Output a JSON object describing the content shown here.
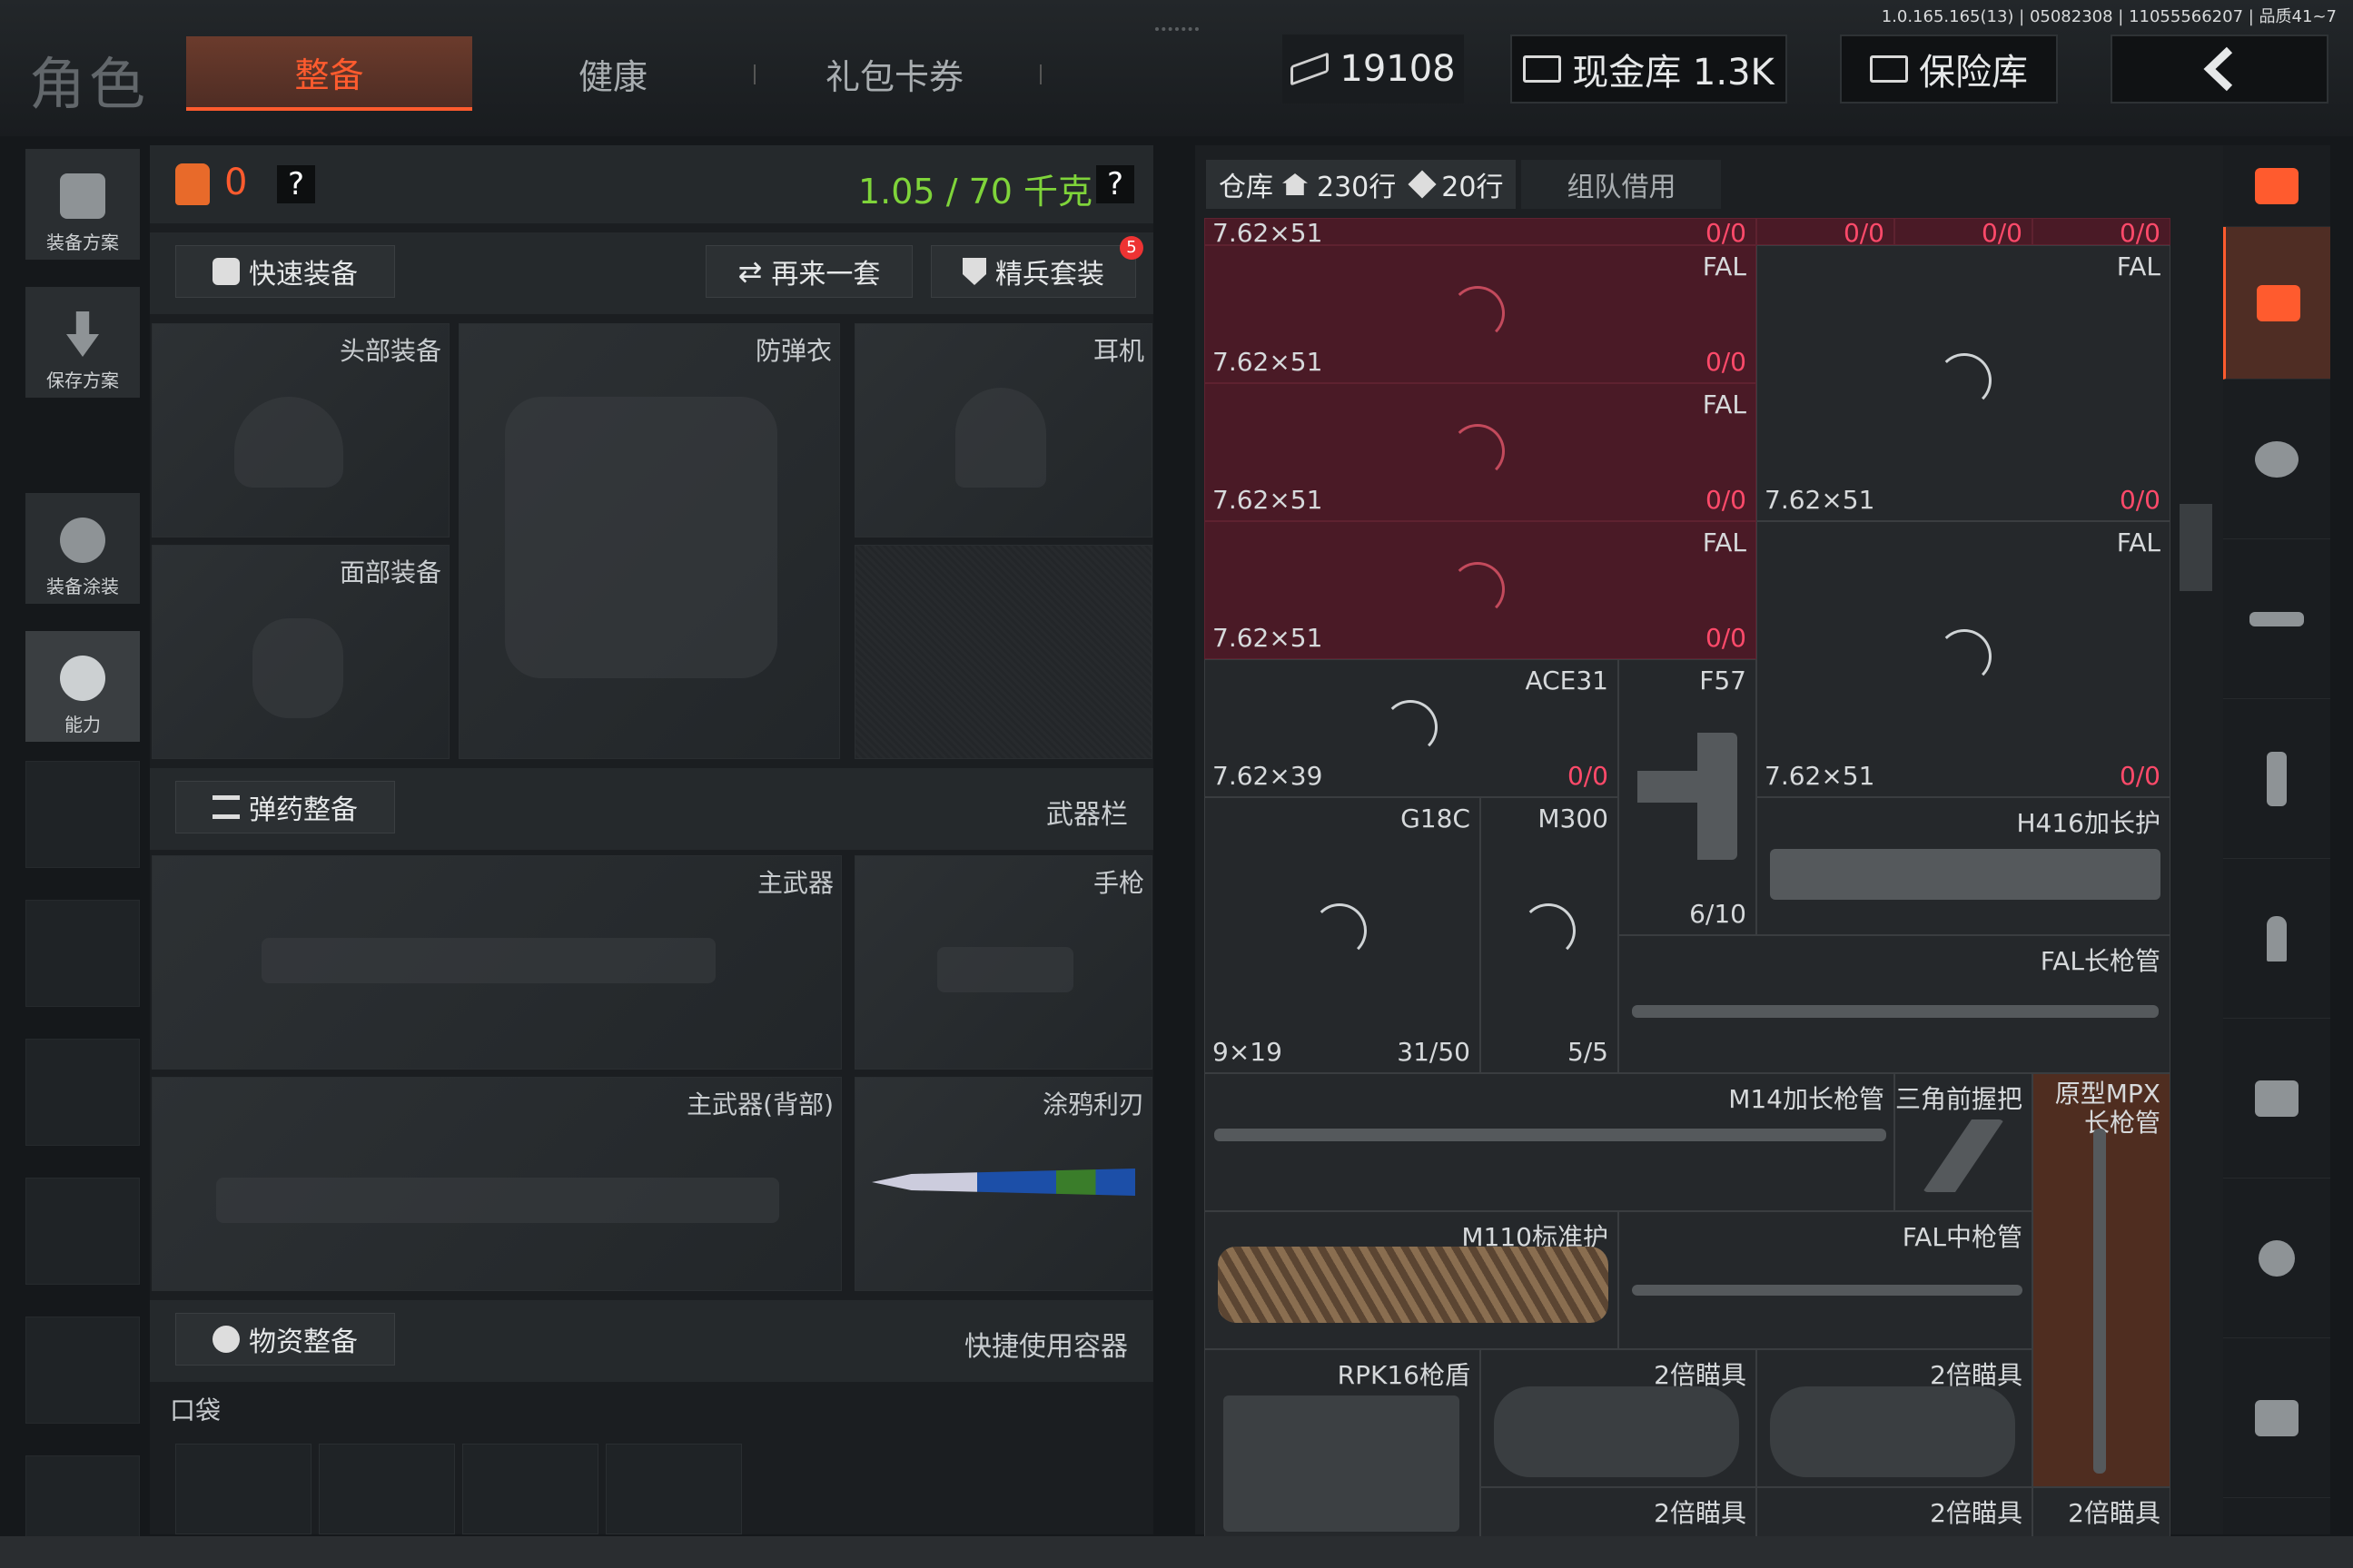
{
  "version": "1.0.165.165(13) | 05082308 | 11055566207 | 品质41~7",
  "title": "角色",
  "tabs": [
    "整备",
    "健康",
    "礼包卡券"
  ],
  "money": "19108",
  "cash": "现金库 1.3K",
  "safe": "保险库",
  "leftnav": [
    "装备方案",
    "保存方案",
    "装备涂装",
    "能力"
  ],
  "loadout": {
    "count": "0",
    "q": "?",
    "weight": "1.05 / 70 千克",
    "quick": "快速装备",
    "again": "再来一套",
    "elite": "精兵套装",
    "elite_badge": "5"
  },
  "slots": {
    "head": "头部装备",
    "armor": "防弹衣",
    "ear": "耳机",
    "face": "面部装备",
    "ammo": "弹药整备",
    "weapon_bar": "武器栏",
    "main": "主武器",
    "pistol": "手枪",
    "mainback": "主武器(背部)",
    "knife": "涂鸦利刃",
    "supply": "物资整备",
    "quickuse": "快捷使用容器",
    "pocket": "口袋"
  },
  "warehouse": {
    "title": "仓库",
    "rows": "230行",
    "rows2": "20行",
    "team": "组队借用"
  },
  "cells": [
    {
      "n": "FAL",
      "cal": "7.62×51",
      "amt": "0/0"
    },
    {
      "n": "FAL",
      "cal": "7.62×51",
      "amt": "0/0"
    },
    {
      "n": "FAL",
      "cal": "7.62×51",
      "amt": "0/0"
    },
    {
      "n": "FAL",
      "cal": "7.62×51",
      "amt": "0/0"
    },
    {
      "n": "FAL",
      "cal": "7.62×51",
      "amt": "0/0"
    },
    {
      "n": "ACE31",
      "cal": "7.62×39",
      "amt": "0/0"
    },
    {
      "n": "F57",
      "cal": "",
      "amt": "6/10"
    },
    {
      "n": "",
      "cal": "7.62×51",
      "amt": "0/0"
    },
    {
      "n": "G18C",
      "cal": "9×19",
      "amt": "31/50"
    },
    {
      "n": "M300",
      "cal": "",
      "amt": "5/5"
    },
    {
      "n": "H416加长护",
      "cal": "",
      "amt": ""
    },
    {
      "n": "FAL长枪管",
      "cal": "",
      "amt": ""
    },
    {
      "n": "M14加长枪管",
      "cal": "",
      "amt": ""
    },
    {
      "n": "三角前握把",
      "cal": "",
      "amt": ""
    },
    {
      "n": "原型MPX长枪管",
      "cal": "",
      "amt": ""
    },
    {
      "n": "M110标准护",
      "cal": "",
      "amt": ""
    },
    {
      "n": "FAL中枪管",
      "cal": "",
      "amt": ""
    },
    {
      "n": "RPK16枪盾",
      "cal": "",
      "amt": ""
    },
    {
      "n": "2倍瞄具",
      "cal": "",
      "amt": ""
    },
    {
      "n": "2倍瞄具",
      "cal": "",
      "amt": ""
    },
    {
      "n": "2倍瞄具",
      "cal": "",
      "amt": ""
    },
    {
      "n": "2倍瞄具",
      "cal": "",
      "amt": ""
    },
    {
      "n": "2倍瞄具",
      "cal": "",
      "amt": ""
    }
  ],
  "toprow": {
    "cal": "7.62×51",
    "a": "0/0",
    "b": "0/0",
    "c": "0/0",
    "d": "0/0"
  },
  "accent": "#ff5b2e",
  "red": "#ff4a6a",
  "green": "#7fd43a"
}
